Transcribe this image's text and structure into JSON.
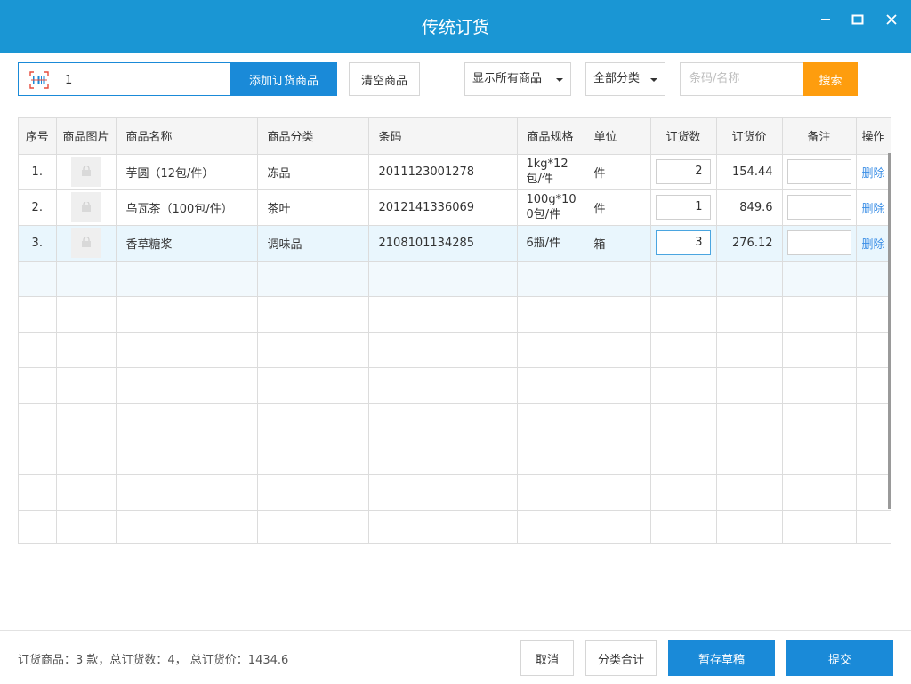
{
  "window": {
    "title": "传统订货"
  },
  "toolbar": {
    "scan_value": "1",
    "add_button": "添加订货商品",
    "clear_button": "清空商品",
    "filter_display": "显示所有商品",
    "filter_category": "全部分类",
    "search_placeholder": "条码/名称",
    "search_button": "搜索"
  },
  "table": {
    "headers": {
      "index": "序号",
      "image": "商品图片",
      "name": "商品名称",
      "category": "商品分类",
      "barcode": "条码",
      "spec": "商品规格",
      "unit": "单位",
      "qty": "订货数",
      "price": "订货价",
      "remark": "备注",
      "action": "操作"
    },
    "delete_label": "删除",
    "rows": [
      {
        "index": "1.",
        "name": "芋圆（12包/件）",
        "category": "冻品",
        "barcode": "2011123001278",
        "spec_line1": "1kg*12",
        "spec_line2": "包/件",
        "unit": "件",
        "qty": "2",
        "price": "154.44"
      },
      {
        "index": "2.",
        "name": "乌瓦茶（100包/件）",
        "category": "茶叶",
        "barcode": "2012141336069",
        "spec_line1": "100g*10",
        "spec_line2": "0包/件",
        "unit": "件",
        "qty": "1",
        "price": "849.6"
      },
      {
        "index": "3.",
        "name": "香草糖浆",
        "category": "调味品",
        "barcode": "2108101134285",
        "spec_line1": "6瓶/件",
        "spec_line2": "",
        "unit": "箱",
        "qty": "3",
        "price": "276.12"
      }
    ]
  },
  "footer": {
    "summary": "订货商品：3 款，总订货数：4，  总订货价：1434.6",
    "cancel_button": "取消",
    "category_total_button": "分类合计",
    "save_draft_button": "暂存草稿",
    "submit_button": "提交"
  },
  "colors": {
    "primary": "#1a8ad8",
    "title_bar": "#1a96d4",
    "search": "#fe9d0e"
  }
}
